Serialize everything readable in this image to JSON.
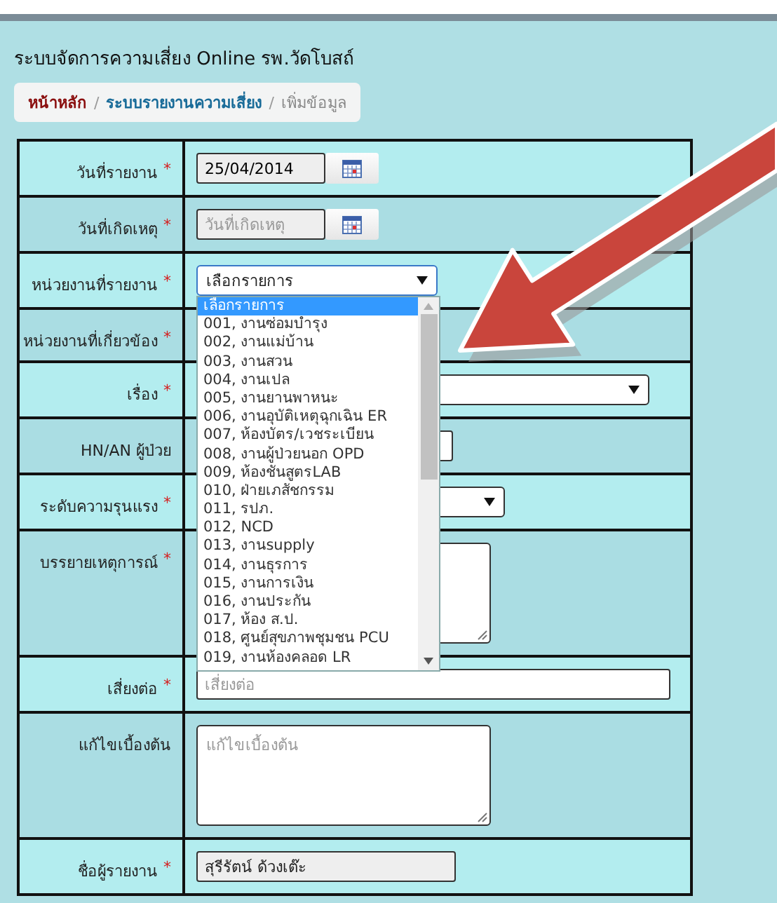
{
  "page": {
    "title": "ระบบจัดการความเสี่ยง Online รพ.วัดโบสถ์"
  },
  "breadcrumb": [
    {
      "label": "หน้าหลัก",
      "kind": "home"
    },
    {
      "label": "ระบบรายงานความเสี่ยง",
      "kind": "link",
      "separator": "/"
    },
    {
      "label": "เพิ่มข้อมูล",
      "kind": "current",
      "separator": "/"
    }
  ],
  "form_rows": [
    {
      "label": "วันที่รายงาน",
      "required_mark": "*",
      "kind": "date",
      "value": "25/04/2014"
    },
    {
      "label": "วันที่เกิดเหตุ",
      "required_mark": "*",
      "kind": "date",
      "placeholder": "วันที่เกิดเหตุ"
    },
    {
      "label": "หน่วยงานที่รายงาน",
      "required_mark": "*",
      "kind": "select",
      "value": "เลือกรายการ",
      "expanded": true
    },
    {
      "label": "หน่วยงานที่เกี่ยวข้อง",
      "required_mark": "*",
      "kind": "covered"
    },
    {
      "label": "เรื่อง",
      "required_mark": "*",
      "kind": "select-wide"
    },
    {
      "label": "HN/AN ผู้ป่วย",
      "kind": "text-short"
    },
    {
      "label": "ระดับความรุนแรง",
      "required_mark": "*",
      "kind": "select-mid"
    },
    {
      "label": "บรรยายเหตุการณ์",
      "required_mark": "*",
      "kind": "textarea"
    },
    {
      "label": "เสี่ยงต่อ",
      "required_mark": "*",
      "kind": "text-wide",
      "placeholder": "เสี่ยงต่อ"
    },
    {
      "label": "แก้ไขเบื้องต้น",
      "kind": "textarea-short",
      "placeholder": "แก้ไขเบื้องต้น"
    },
    {
      "label": "ชื่อผู้รายงาน",
      "required_mark": "*",
      "kind": "readonly",
      "value": "สุรีรัตน์ ด้วงเต๊ะ"
    }
  ],
  "dropdown_options": [
    {
      "label": "เลือกรายการ",
      "selected": true
    },
    {
      "label": "001, งานซ่อมบำรุง",
      "selected": false
    },
    {
      "label": "002, งานแม่บ้าน",
      "selected": false
    },
    {
      "label": "003, งานสวน",
      "selected": false
    },
    {
      "label": "004, งานเปล",
      "selected": false
    },
    {
      "label": "005, งานยานพาหนะ",
      "selected": false
    },
    {
      "label": "006, งานอุบัติเหตุฉุกเฉิน ER",
      "selected": false
    },
    {
      "label": "007, ห้องบัตร/เวชระเบียน",
      "selected": false
    },
    {
      "label": "008, งานผู้ป่วยนอก OPD",
      "selected": false
    },
    {
      "label": "009, ห้องชันสูตรLAB",
      "selected": false
    },
    {
      "label": "010, ฝ่ายเภสัชกรรม",
      "selected": false
    },
    {
      "label": "011, รปภ.",
      "selected": false
    },
    {
      "label": "012, NCD",
      "selected": false
    },
    {
      "label": "013, งานsupply",
      "selected": false
    },
    {
      "label": "014, งานธุรการ",
      "selected": false
    },
    {
      "label": "015, งานการเงิน",
      "selected": false
    },
    {
      "label": "016, งานประกัน",
      "selected": false
    },
    {
      "label": "017, ห้อง ส.ป.",
      "selected": false
    },
    {
      "label": "018, ศูนย์สุขภาพชุมชน PCU",
      "selected": false
    },
    {
      "label": "019, งานห้องคลอด LR",
      "selected": false
    }
  ]
}
